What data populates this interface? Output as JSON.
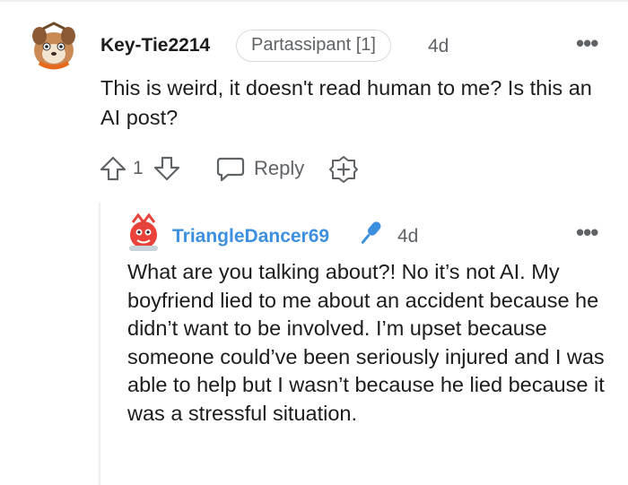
{
  "comment": {
    "username": "Key-Tie2214",
    "flair": "Partassipant [1]",
    "time": "4d",
    "more": "•••",
    "body": "This is weird, it doesn't read human to me? Is this an AI post?",
    "votes": "1",
    "reply_label": "Reply",
    "icons": [
      "avatar",
      "upvote-icon",
      "downvote-icon",
      "reply-icon",
      "award-icon",
      "more-icon"
    ]
  },
  "reply": {
    "username": "TriangleDancer69",
    "time": "4d",
    "more": "•••",
    "body": "What are you talking about?! No it’s not AI. My boyfriend lied to me about an accident because he didn’t want to be involved. I’m upset because someone could’ve been seriously injured and I was able to help but I wasn’t because he lied because it was a stressful situation.",
    "icons": [
      "avatar",
      "microphone-icon",
      "more-icon"
    ]
  },
  "colors": {
    "text": "#1c1c1c",
    "meta": "#5f6366",
    "username_link": "#3d8fe0",
    "flair_border": "#d7dadc",
    "thread_line": "#edeff1"
  }
}
